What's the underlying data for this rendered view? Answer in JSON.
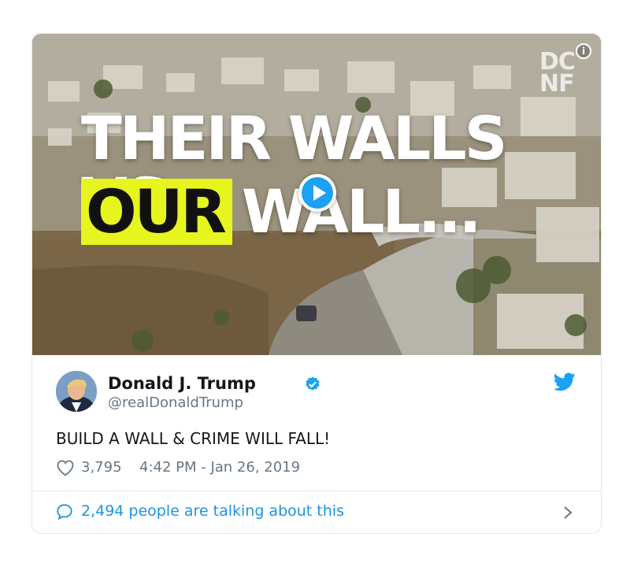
{
  "media": {
    "headline_line1": "THEIR WALLS VS",
    "headline_highlight": "OUR",
    "headline_line2_rest": "WALL...",
    "watermark": "DC NF",
    "info_glyph": "i",
    "highlight_color": "#e6f51d",
    "play_color": "#1da1f2"
  },
  "tweet": {
    "author_name": "Donald J. Trump",
    "handle": "@realDonaldTrump",
    "text": "BUILD A WALL & CRIME WILL FALL!",
    "likes": "3,795",
    "timestamp": "4:42 PM - Jan 26, 2019",
    "talking": "2,494 people are talking about this",
    "verified_icon": "verified-badge-icon",
    "brand_icon": "twitter-bird-icon",
    "accent_color": "#1da1f2",
    "link_color": "#1b95e0"
  }
}
